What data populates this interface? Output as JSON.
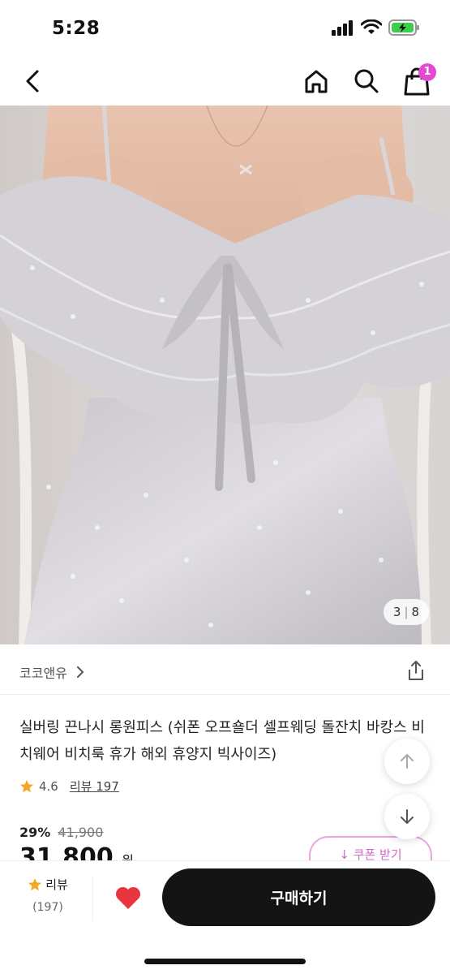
{
  "status": {
    "time": "5:28"
  },
  "nav": {
    "cart_count": "1"
  },
  "image": {
    "current": "3",
    "total": "8"
  },
  "brand": {
    "name": "코코앤유"
  },
  "product": {
    "title": "실버링  끈나시 롱원피스 (쉬폰 오프숄더 셀프웨딩 돌잔치 바캉스 비치웨어 비치룩 휴가 해외 휴양지 빅사이즈)",
    "rating": "4.6",
    "review_link": "리뷰 197",
    "discount": "29%",
    "original_price": "41,900",
    "sale_price": "31,800",
    "price_unit": "원"
  },
  "coupon": {
    "label": "쿠폰 받기"
  },
  "bottom": {
    "review_label": "리뷰",
    "review_count": "(197)",
    "buy_label": "구매하기"
  },
  "colors": {
    "accent": "#e34ad0",
    "buy_button": "#141414",
    "heart": "#e8363f",
    "star": "#f5a623"
  }
}
